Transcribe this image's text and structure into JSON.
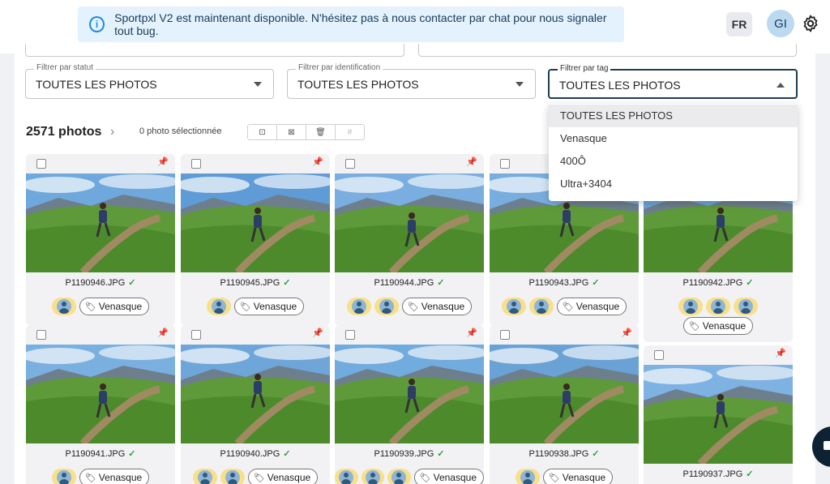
{
  "banner": {
    "message": "Sportpxl V2 est maintenant disponible. N'hésitez pas à nous contacter par chat pour nous signaler tout bug."
  },
  "header": {
    "lang": "FR",
    "avatar": "GI"
  },
  "filters": [
    {
      "label": "Filtrer par statut",
      "value": "TOUTES LES PHOTOS"
    },
    {
      "label": "Filtrer par identification",
      "value": "TOUTES LES PHOTOS"
    },
    {
      "label": "Filtrer par tag",
      "value": "TOUTES LES PHOTOS"
    }
  ],
  "dropdown": {
    "options": [
      "TOUTES LES PHOTOS",
      "Venasque",
      "400Ô",
      "Ultra+3404"
    ],
    "selected": 0
  },
  "summary": {
    "count": "2571 photos",
    "selected": "0 photo sélectionnée"
  },
  "colors": {
    "accent": "#1f3d52",
    "check": "#2e9d47",
    "person_badge": "#f8e08a",
    "banner_bg": "#e3f2fd"
  },
  "photos": [
    {
      "name": "P1190946.JPG",
      "people": 1,
      "tag": "Venasque"
    },
    {
      "name": "P1190945.JPG",
      "people": 1,
      "tag": "Venasque"
    },
    {
      "name": "P1190944.JPG",
      "people": 2,
      "tag": "Venasque"
    },
    {
      "name": "P1190943.JPG",
      "people": 2,
      "tag": "Venasque"
    },
    {
      "name": "P1190942.JPG",
      "people": 3,
      "tag": "Venasque"
    },
    {
      "name": "P1190941.JPG",
      "people": 1,
      "tag": "Venasque"
    },
    {
      "name": "P1190940.JPG",
      "people": 2,
      "tag": "Venasque"
    },
    {
      "name": "P1190939.JPG",
      "people": 3,
      "tag": "Venasque"
    },
    {
      "name": "P1190938.JPG",
      "people": 1,
      "tag": "Venasque"
    },
    {
      "name": "P1190937.JPG",
      "people": 0,
      "tag": ""
    }
  ]
}
